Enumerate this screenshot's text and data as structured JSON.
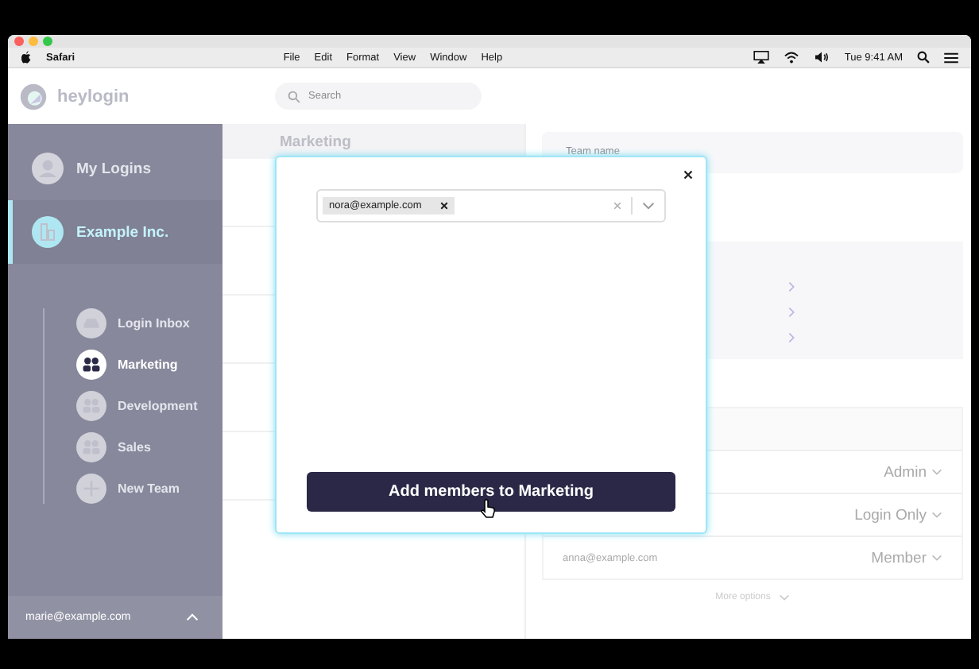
{
  "menubar": {
    "app": "Safari",
    "menus": [
      "File",
      "Edit",
      "Format",
      "View",
      "Window",
      "Help"
    ],
    "clock": "Tue 9:41 AM"
  },
  "header": {
    "logo": "heylogin",
    "search": {
      "placeholder": "Search"
    }
  },
  "sidebar": {
    "items": [
      {
        "label": "My Logins",
        "kind": "user",
        "selected": false
      },
      {
        "label": "Example Inc.",
        "kind": "org",
        "selected": true
      }
    ],
    "teams": [
      {
        "label": "Login Inbox",
        "kind": "inbox",
        "selected": false
      },
      {
        "label": "Marketing",
        "kind": "team",
        "selected": true
      },
      {
        "label": "Development",
        "kind": "team",
        "selected": false
      },
      {
        "label": "Sales",
        "kind": "team",
        "selected": false
      },
      {
        "label": "New Team",
        "kind": "add",
        "selected": false
      }
    ],
    "account": "marie@example.com"
  },
  "team_list": {
    "title": "Marketing"
  },
  "details": {
    "team_name_label": "Team name",
    "members": [
      {
        "role": "Admin"
      },
      {
        "role": "Login Only"
      },
      {
        "email": "anna@example.com",
        "role": "Member"
      }
    ],
    "more_options": "More options"
  },
  "modal": {
    "tags": [
      "nora@example.com"
    ],
    "button": "Add members to Marketing"
  }
}
